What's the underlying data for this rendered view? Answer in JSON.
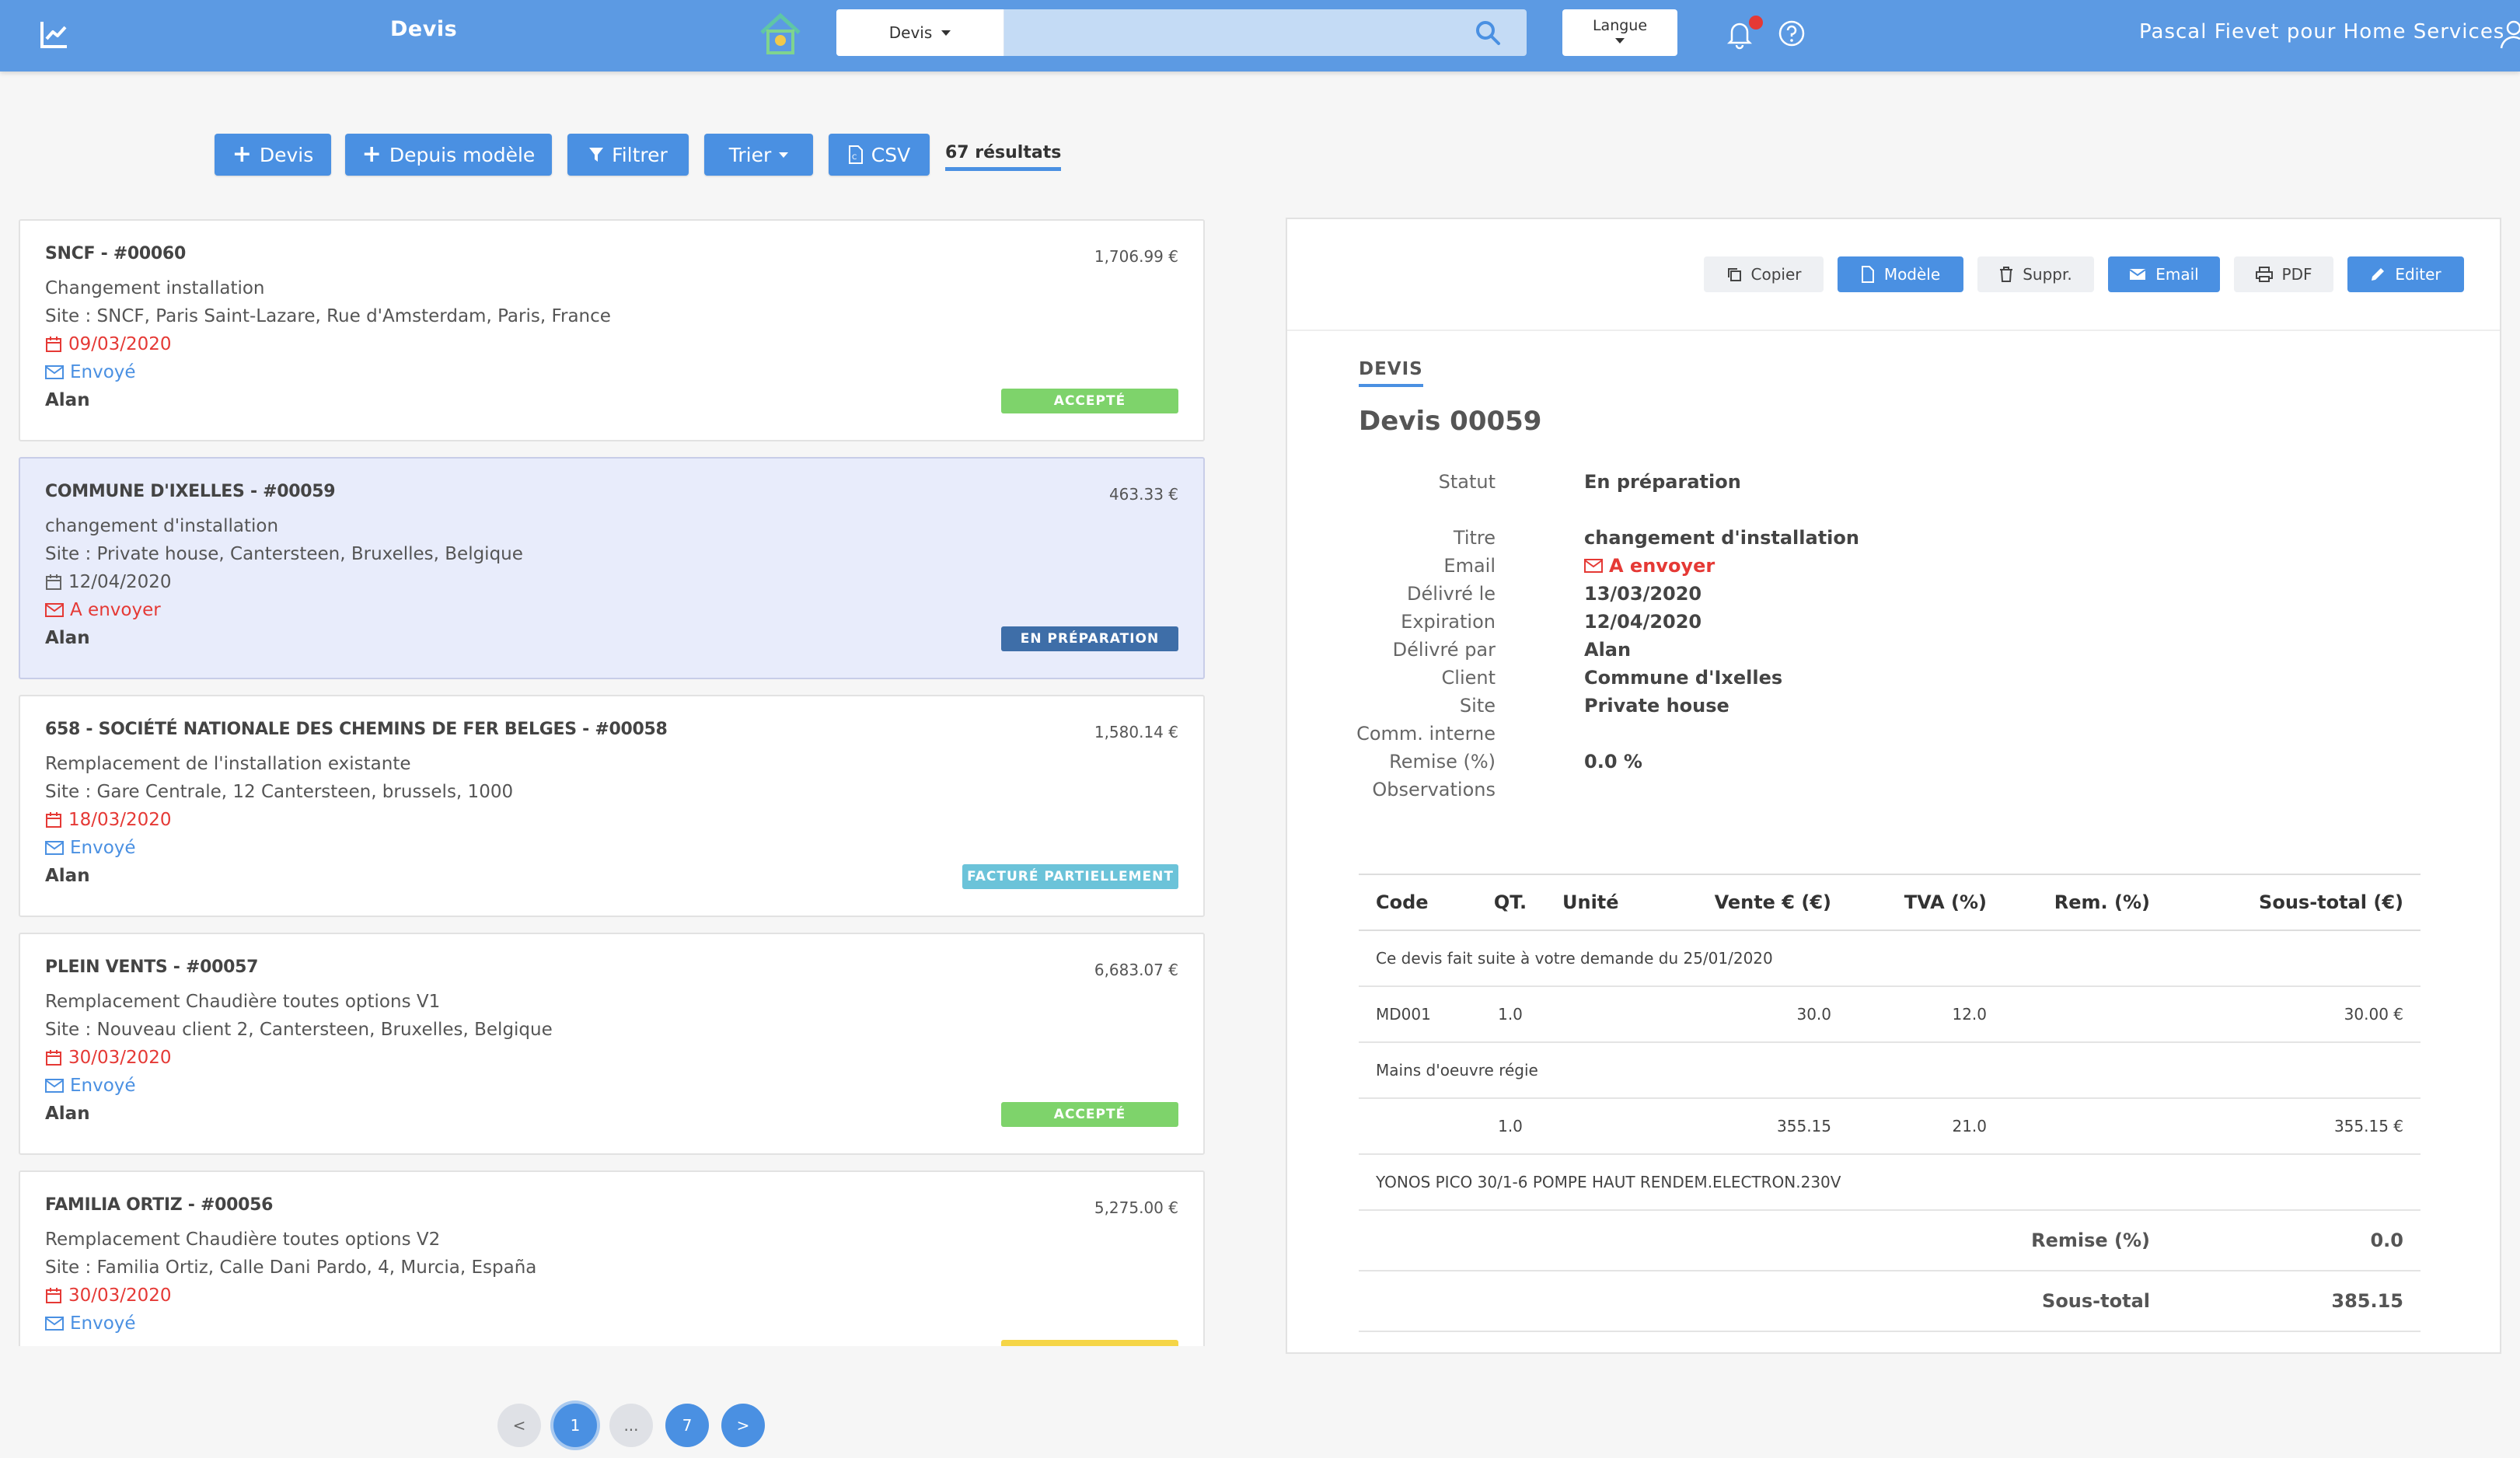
{
  "navbar": {
    "title": "Devis",
    "search_scope": "Devis",
    "search_placeholder": "",
    "language_label": "Langue",
    "user_label": "Pascal Fievet pour Home Services"
  },
  "toolbar": {
    "add_devis": "Devis",
    "from_template": "Depuis modèle",
    "filter": "Filtrer",
    "sort": "Trier",
    "csv": "CSV",
    "result_count": "67 résultats"
  },
  "quotes": [
    {
      "title": "SNCF - #00060",
      "amount": "1,706.99 €",
      "description": "Changement installation",
      "site": "Site : SNCF, Paris Saint-Lazare, Rue d'Amsterdam, Paris, France",
      "date": "09/03/2020",
      "mail_status": "Envoyé",
      "author": "Alan",
      "badge": "ACCEPTÉ",
      "badge_color": "#7ed36b"
    },
    {
      "title": "COMMUNE D'IXELLES - #00059",
      "amount": "463.33 €",
      "description": "changement d'installation",
      "site": "Site : Private house, Cantersteen, Bruxelles, Belgique",
      "date": "12/04/2020",
      "mail_status": "A envoyer",
      "author": "Alan",
      "badge": "EN PRÉPARATION",
      "badge_color": "#3e6ea8"
    },
    {
      "title": "658 - SOCIÉTÉ NATIONALE DES CHEMINS DE FER BELGES - #00058",
      "amount": "1,580.14 €",
      "description": "Remplacement de l'installation existante",
      "site": "Site : Gare Centrale, 12 Cantersteen, brussels, 1000",
      "date": "18/03/2020",
      "mail_status": "Envoyé",
      "author": "Alan",
      "badge": "FACTURÉ PARTIELLEMENT",
      "badge_color": "#6bc3d9"
    },
    {
      "title": "PLEIN VENTS - #00057",
      "amount": "6,683.07 €",
      "description": "Remplacement Chaudière toutes options V1",
      "site": "Site : Nouveau client 2, Cantersteen, Bruxelles, Belgique",
      "date": "30/03/2020",
      "mail_status": "Envoyé",
      "author": "Alan",
      "badge": "ACCEPTÉ",
      "badge_color": "#7ed36b"
    },
    {
      "title": "FAMILIA ORTIZ - #00056",
      "amount": "5,275.00 €",
      "description": "Remplacement Chaudière toutes options V2",
      "site": "Site : Familia Ortiz, Calle Dani Pardo, 4, Murcia, España",
      "date": "30/03/2020",
      "mail_status": "Envoyé",
      "author": "",
      "badge": "",
      "badge_color": "#f5d547"
    }
  ],
  "pagination": {
    "prev": "<",
    "current": "1",
    "ellipsis": "...",
    "last": "7",
    "next": ">"
  },
  "detail": {
    "actions": {
      "copy": "Copier",
      "template": "Modèle",
      "delete": "Suppr.",
      "email": "Email",
      "pdf": "PDF",
      "edit": "Editer"
    },
    "tab": "DEVIS",
    "heading": "Devis 00059",
    "fields": {
      "status_label": "Statut",
      "status_value": "En préparation",
      "title_label": "Titre",
      "title_value": "changement d'installation",
      "email_label": "Email",
      "email_value": "A envoyer",
      "issued_label": "Délivré le",
      "issued_value": "13/03/2020",
      "expiry_label": "Expiration",
      "expiry_value": "12/04/2020",
      "issued_by_label": "Délivré par",
      "issued_by_value": "Alan",
      "client_label": "Client",
      "client_value": "Commune d'Ixelles",
      "site_label": "Site",
      "site_value": "Private house",
      "internal_label": "Comm. interne",
      "discount_label": "Remise (%)",
      "discount_value": "0.0 %",
      "observations_label": "Observations"
    },
    "table": {
      "headers": [
        "Code",
        "QT.",
        "Unité",
        "Vente € (€)",
        "TVA (%)",
        "Rem. (%)",
        "Sous-total (€)"
      ],
      "note1": "Ce devis fait suite à votre demande du 25/01/2020",
      "row1": {
        "code": "MD001",
        "qty": "1.0",
        "unit": "",
        "price": "30.0",
        "vat": "12.0",
        "discount": "",
        "subtotal": "30.00 €"
      },
      "note2": "Mains d'oeuvre régie",
      "row2": {
        "code": "",
        "qty": "1.0",
        "unit": "",
        "price": "355.15",
        "vat": "21.0",
        "discount": "",
        "subtotal": "355.15 €"
      },
      "note3": "YONOS PICO 30/1-6 POMPE HAUT RENDEM.ELECTRON.230V",
      "discount_label": "Remise (%)",
      "discount_value": "0.0",
      "subtotal_label": "Sous-total",
      "subtotal_value": "385.15"
    }
  },
  "colors": {
    "navbar": "#5c9ae3",
    "primary": "#4a90e2",
    "danger": "#e53935"
  }
}
